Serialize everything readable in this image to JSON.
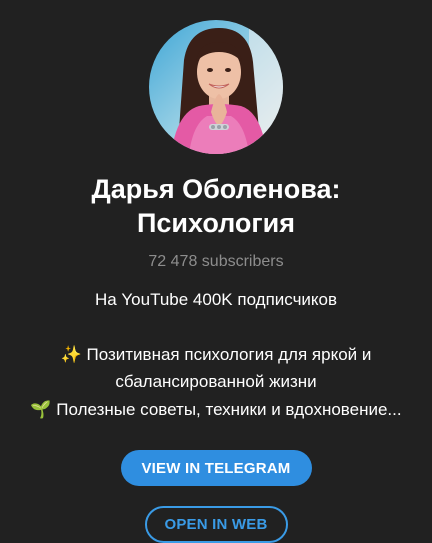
{
  "channel": {
    "title_line1": "Дарья Оболенова:",
    "title_line2": "Психология",
    "subscribers": "72 478 subscribers",
    "avatar_icon": "channel-avatar"
  },
  "description": {
    "line1": "На YouTube 400K подписчиков",
    "line2": "✨ Позитивная психология для яркой и",
    "line3": "сбалансированной жизни",
    "line4": "🌱 Полезные советы, техники и вдохновение..."
  },
  "actions": {
    "view_in_telegram": "VIEW IN TELEGRAM",
    "open_in_web": "OPEN IN WEB"
  },
  "colors": {
    "background": "#212121",
    "accent": "#2f8ee0",
    "muted_text": "#8d8d8d"
  }
}
